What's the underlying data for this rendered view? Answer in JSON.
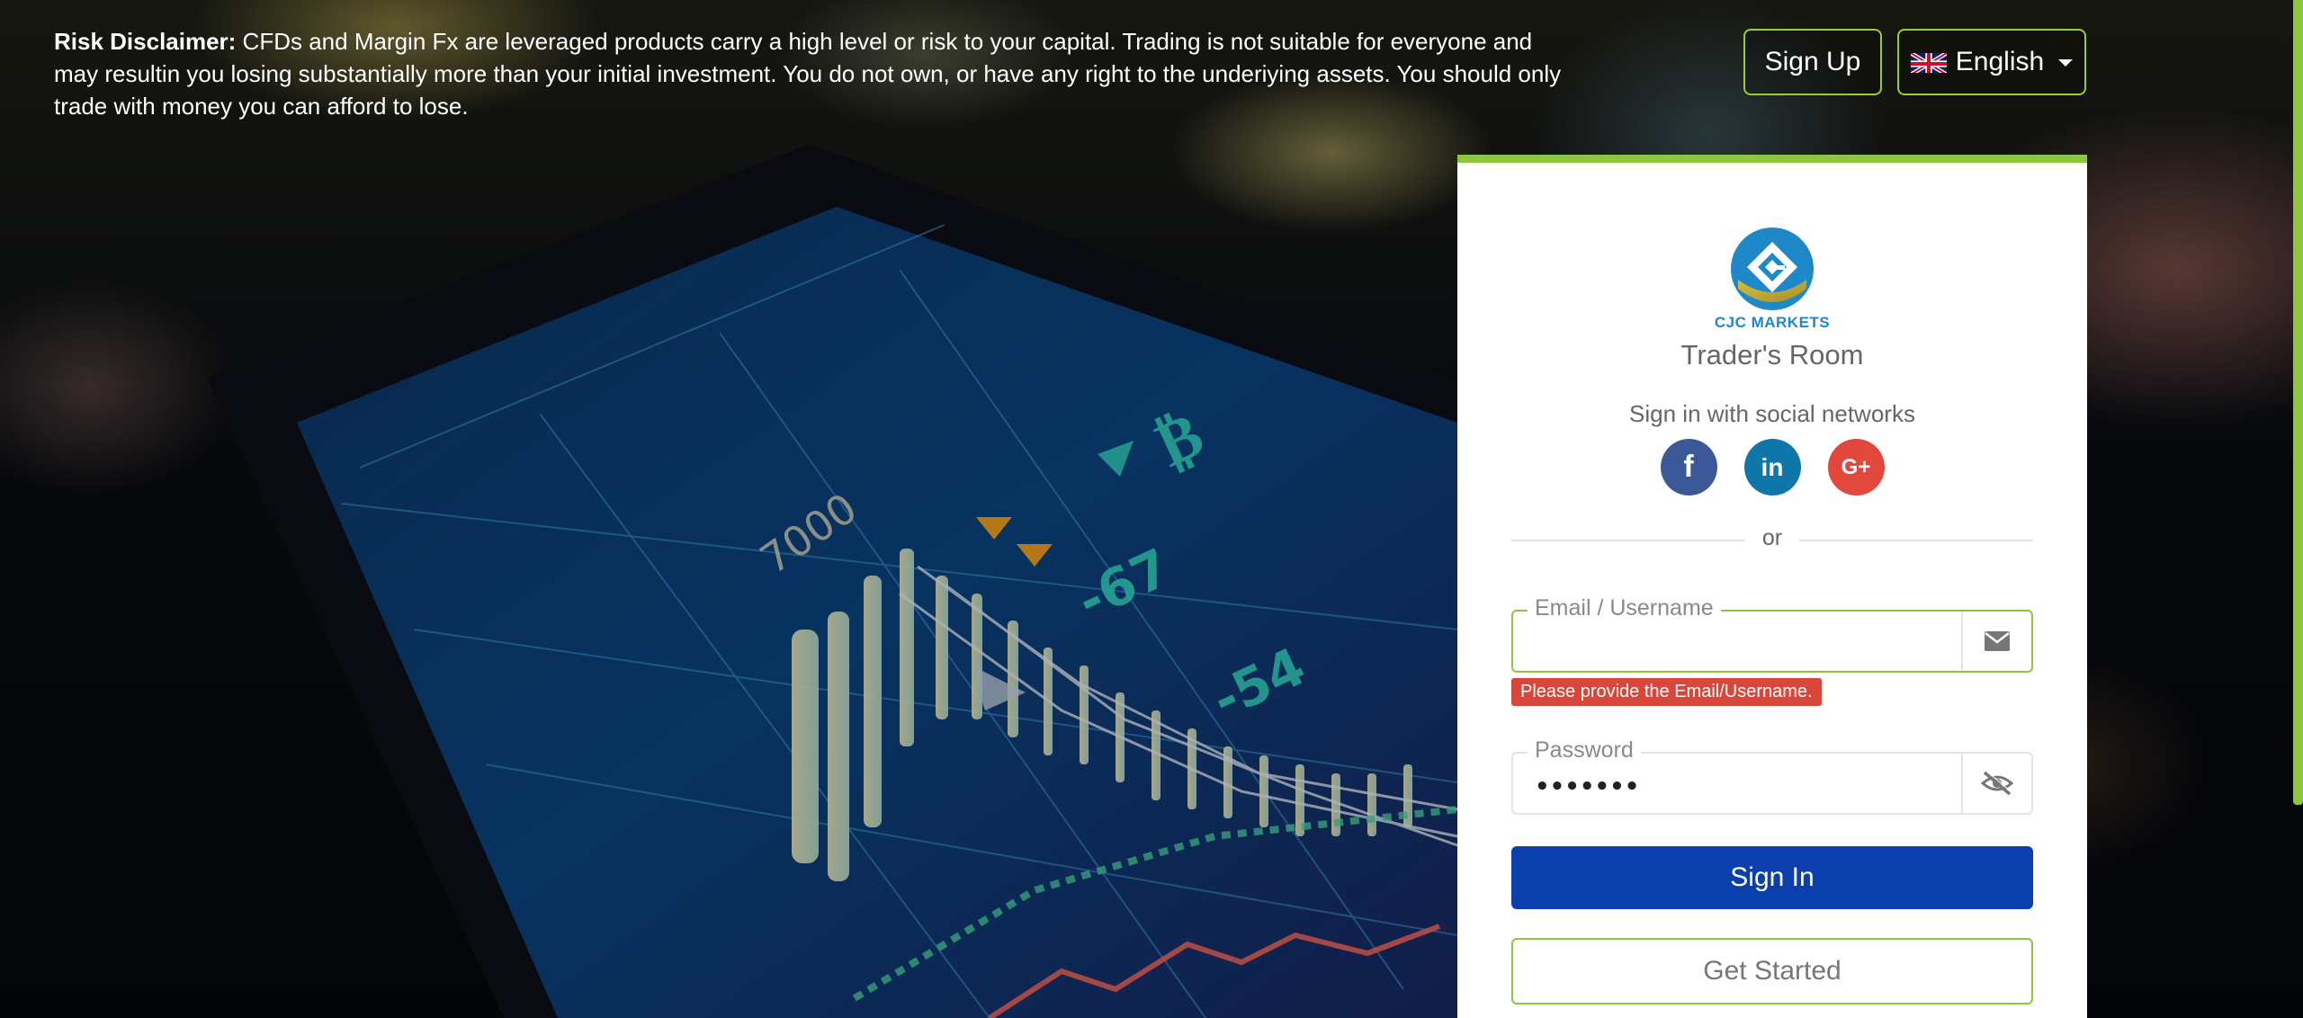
{
  "disclaimer": {
    "label": "Risk Disclaimer:",
    "text": " CFDs and Margin Fx are leveraged products carry a high level or risk to your capital. Trading is not suitable for everyone and may resultin you losing substantially more than your initial investment. You do not own, or have any right to the underiying assets. You should only trade with money you can afford to lose."
  },
  "header": {
    "signup_label": "Sign Up",
    "language": {
      "selected": "English",
      "flag_icon": "uk-flag-icon"
    }
  },
  "card": {
    "brand_name": "CJC MARKETS",
    "title": "Trader's Room",
    "social_prompt": "Sign in with social networks",
    "social": [
      {
        "name": "facebook",
        "glyph": "f",
        "color": "#3b5998"
      },
      {
        "name": "linkedin",
        "glyph": "in",
        "color": "#0e76a8"
      },
      {
        "name": "google-plus",
        "glyph": "G+",
        "color": "#e2473b"
      }
    ],
    "divider_text": "or",
    "email": {
      "label": "Email / Username",
      "value": "",
      "icon": "envelope-icon",
      "error": "Please provide the Email/Username."
    },
    "password": {
      "label": "Password",
      "value": "•••••••",
      "icon": "eye-slash-icon"
    },
    "signin_label": "Sign In",
    "get_started_label": "Get Started"
  },
  "colors": {
    "accent_green": "#8cc63f",
    "primary_blue": "#0b3fae",
    "error_red": "#d9463a",
    "brand_blue": "#1e88c8"
  }
}
